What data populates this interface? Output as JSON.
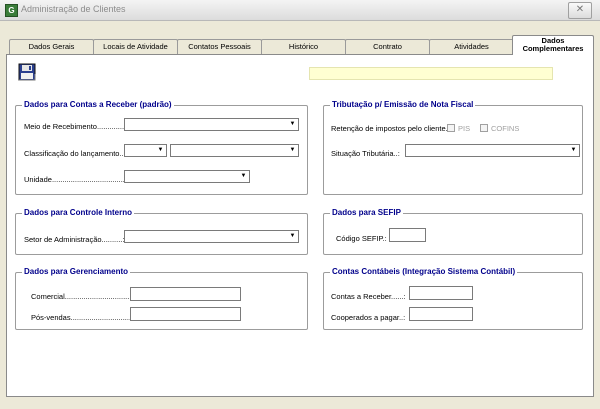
{
  "window": {
    "title": "Administração de Clientes",
    "close_glyph": "✕",
    "icon": "app-icon"
  },
  "tabs": [
    {
      "label": "Dados Gerais"
    },
    {
      "label": "Locais de Atividade"
    },
    {
      "label": "Contatos Pessoais"
    },
    {
      "label": "Histórico"
    },
    {
      "label": "Contrato"
    },
    {
      "label": "Atividades"
    },
    {
      "label": "Dados Complementares",
      "active": true
    }
  ],
  "toolbar": {
    "save_icon": "save-disk-icon"
  },
  "groups": {
    "contas_receber": {
      "title": "Dados para Contas a Receber (padrão)",
      "meio_label": "Meio de Recebimento...............:",
      "classificacao_label": "Classificação do lançamento..:",
      "unidade_label": "Unidade.........................................:"
    },
    "tributacao": {
      "title": "Tributação p/ Emissão de Nota Fiscal",
      "retencao_label": "Retenção de impostos pelo cliente.:",
      "pis_label": "PIS",
      "cofins_label": "COFINS",
      "situacao_label": "Situação Tributária..:"
    },
    "controle_interno": {
      "title": "Dados para Controle Interno",
      "setor_label": "Setor de Administração..........:"
    },
    "sefip": {
      "title": "Dados para SEFIP",
      "codigo_label": "Código SEFIP.:"
    },
    "gerenciamento": {
      "title": "Dados para Gerenciamento",
      "comercial_label": "Comercial...................................:",
      "posvendas_label": "Pós-vendas...............................:"
    },
    "contas_contabeis": {
      "title": "Contas Contábeis (Integração Sistema Contábil)",
      "receber_label": "Contas a Receber......:",
      "pagar_label": "Cooperados a pagar..:"
    }
  },
  "dropdown_glyph": "▼"
}
